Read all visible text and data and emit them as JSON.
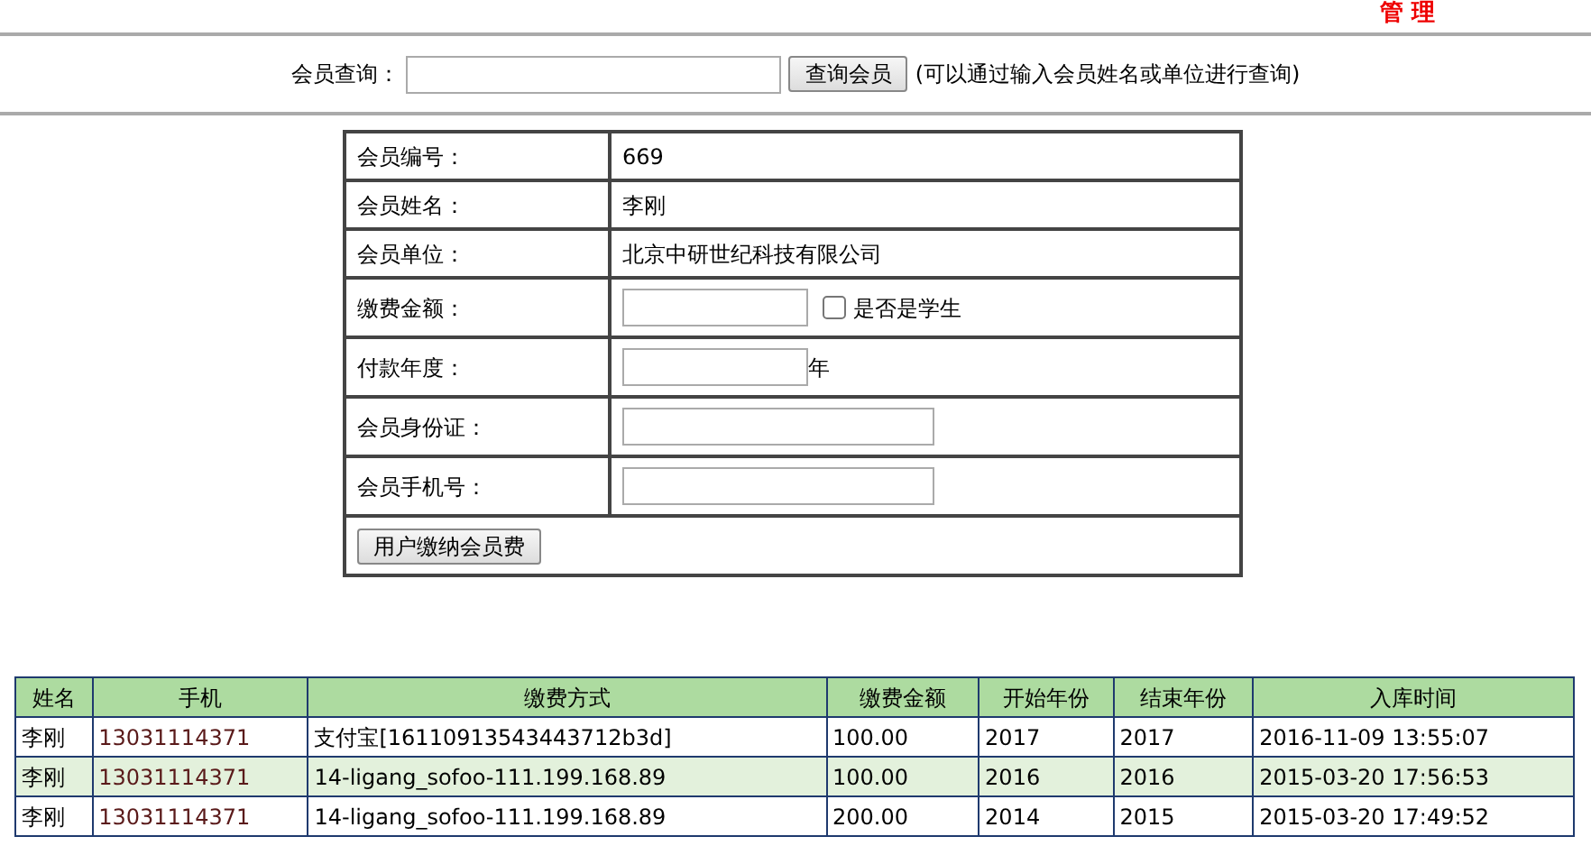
{
  "header": {
    "title": "管 理"
  },
  "search": {
    "label": "会员查询：",
    "button": "查询会员",
    "hint": "(可以通过输入会员姓名或单位进行查询)"
  },
  "form": {
    "rows": [
      {
        "label": "会员编号：",
        "kind": "text",
        "value": "669"
      },
      {
        "label": "会员姓名：",
        "kind": "text",
        "value": "李刚"
      },
      {
        "label": "会员单位：",
        "kind": "text",
        "value": "北京中研世纪科技有限公司"
      },
      {
        "label": "缴费金额：",
        "kind": "amount",
        "checkbox": {
          "label": "是否是学生",
          "checked": false
        }
      },
      {
        "label": "付款年度：",
        "kind": "year",
        "suffix": "年"
      },
      {
        "label": "会员身份证：",
        "kind": "input"
      },
      {
        "label": "会员手机号：",
        "kind": "input"
      }
    ],
    "submit": "用户缴纳会员费"
  },
  "history": {
    "columns": [
      "姓名",
      "手机",
      "缴费方式",
      "缴费金额",
      "开始年份",
      "结束年份",
      "入库时间"
    ],
    "rows": [
      [
        "李刚",
        "13031114371",
        "支付宝[16110913543443712b3d]",
        "100.00",
        "2017",
        "2017",
        "2016-11-09 13:55:07"
      ],
      [
        "李刚",
        "13031114371",
        "14-ligang_sofoo-111.199.168.89",
        "100.00",
        "2016",
        "2016",
        "2015-03-20 17:56:53"
      ],
      [
        "李刚",
        "13031114371",
        "14-ligang_sofoo-111.199.168.89",
        "200.00",
        "2014",
        "2015",
        "2015-03-20 17:49:52"
      ]
    ]
  }
}
